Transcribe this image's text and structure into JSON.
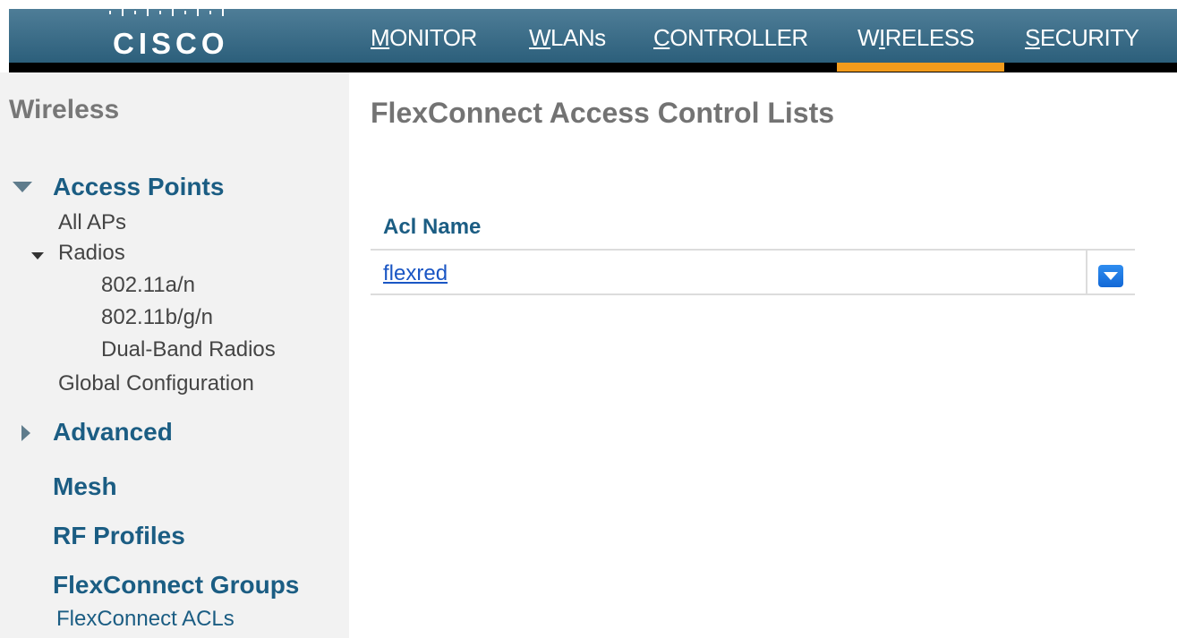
{
  "header": {
    "logo_text": "CISCO",
    "nav": [
      {
        "label": "MONITOR",
        "underline": "M",
        "rest": "ONITOR"
      },
      {
        "label": "WLANs",
        "underline": "W",
        "rest": "LANs"
      },
      {
        "label": "CONTROLLER",
        "underline": "C",
        "rest": "ONTROLLER"
      },
      {
        "label": "WIRELESS",
        "pre": "W",
        "underline": "I",
        "rest": "RELESS"
      },
      {
        "label": "SECURITY",
        "underline": "S",
        "rest": "ECURITY"
      }
    ],
    "active": "WIRELESS",
    "accent_color": "#f19b1c"
  },
  "sidebar": {
    "title": "Wireless",
    "access_points": {
      "label": "Access Points",
      "expanded": true,
      "items": {
        "all_aps": "All APs",
        "radios": "Radios",
        "radio_80211an": "802.11a/n",
        "radio_80211bgn": "802.11b/g/n",
        "dual_band": "Dual-Band Radios",
        "global_config": "Global Configuration"
      }
    },
    "advanced": {
      "label": "Advanced",
      "expanded": false
    },
    "mesh": "Mesh",
    "rf_profiles": "RF Profiles",
    "flexconnect_groups": "FlexConnect Groups",
    "flexconnect_acls": "FlexConnect ACLs"
  },
  "main": {
    "title": "FlexConnect Access Control Lists",
    "table": {
      "columns": [
        "Acl Name"
      ],
      "rows": [
        {
          "acl_name": "flexred"
        }
      ]
    }
  },
  "icons": [
    "cisco-logo",
    "triangle-down-icon",
    "triangle-right-icon",
    "dropdown-arrow-icon"
  ]
}
